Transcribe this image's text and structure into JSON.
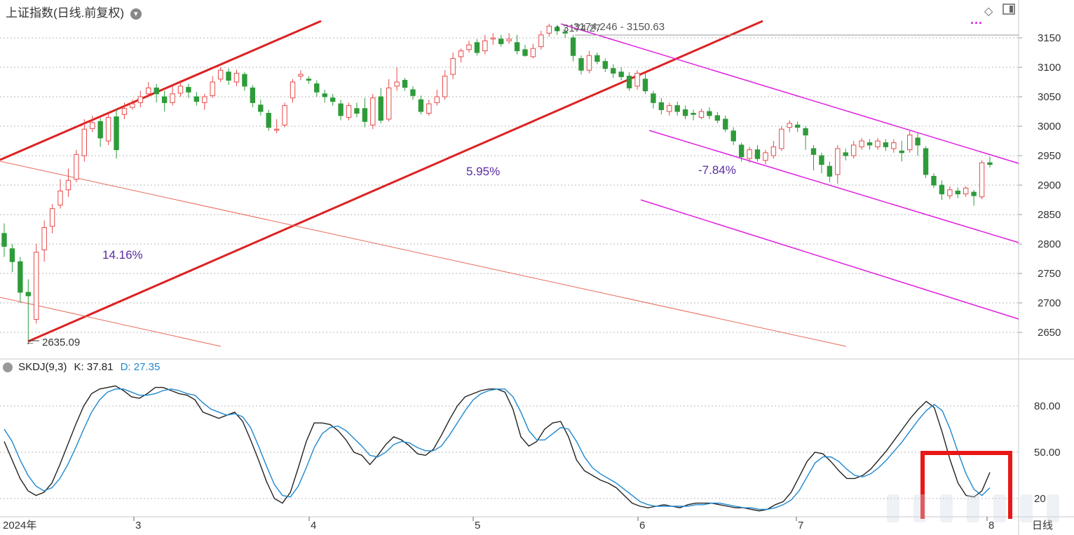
{
  "header": {
    "title": "上证指数(日线.前复权)",
    "dropdown_icon": "chevron-down-icon",
    "draw_tool_icon": "diamond-icon",
    "panel_toggle_icon": "panel-icon",
    "legend_dots": "..."
  },
  "indicator": {
    "name": "SKDJ(9,3)",
    "k_label": "K: 37.81",
    "d_label": "D: 27.35",
    "gear_icon": "gear-icon"
  },
  "colors": {
    "up": "#e84a4a",
    "down": "#2e9b3a",
    "trend_red": "#dd2222",
    "trend_thin": "#e86a5a",
    "channel_magenta": "#e020e0",
    "k_line": "#222222",
    "d_line": "#1e88d0",
    "grid": "#b8b8b8",
    "annot_purple": "#5a2aa0",
    "highlight_box": "#e81818"
  },
  "chart_data": [
    {
      "type": "candlestick",
      "title": "上证指数(日线.前复权)",
      "y_axis_labels": [
        "3150",
        "3100",
        "3050",
        "3000",
        "2950",
        "2900",
        "2850",
        "2800",
        "2750",
        "2700",
        "2650"
      ],
      "ylim": [
        2620,
        3185
      ],
      "x_axis_labels": [
        "2024年",
        "3",
        "4",
        "5",
        "6",
        "7",
        "8",
        "日线"
      ],
      "annotations": {
        "low": "2635.09",
        "high": "3174.27",
        "high_range": "3174.246 - 3150.63",
        "pct_up_1": "14.16%",
        "pct_up_2": "5.95%",
        "pct_down": "-7.84%"
      },
      "candles": [
        [
          2818,
          2796,
          2835,
          2778
        ],
        [
          2792,
          2770,
          2800,
          2752
        ],
        [
          2770,
          2718,
          2778,
          2700
        ],
        [
          2718,
          2712,
          2740,
          2635
        ],
        [
          2672,
          2786,
          2800,
          2665
        ],
        [
          2790,
          2828,
          2840,
          2770
        ],
        [
          2830,
          2860,
          2868,
          2818
        ],
        [
          2866,
          2890,
          2910,
          2860
        ],
        [
          2892,
          2908,
          2928,
          2880
        ],
        [
          2910,
          2952,
          2960,
          2905
        ],
        [
          2950,
          2995,
          3012,
          2940
        ],
        [
          2996,
          3006,
          3018,
          2990
        ],
        [
          3008,
          2980,
          3014,
          2965
        ],
        [
          2975,
          3015,
          3022,
          2968
        ],
        [
          3016,
          2960,
          3030,
          2945
        ],
        [
          3020,
          3030,
          3040,
          3012
        ],
        [
          3032,
          3038,
          3045,
          3028
        ],
        [
          3040,
          3050,
          3060,
          3032
        ],
        [
          3055,
          3065,
          3075,
          3050
        ],
        [
          3065,
          3055,
          3072,
          3040
        ],
        [
          3050,
          3040,
          3060,
          3025
        ],
        [
          3040,
          3055,
          3068,
          3035
        ],
        [
          3056,
          3068,
          3078,
          3050
        ],
        [
          3066,
          3058,
          3072,
          3048
        ],
        [
          3050,
          3042,
          3058,
          3035
        ],
        [
          3040,
          3050,
          3055,
          3028
        ],
        [
          3052,
          3075,
          3085,
          3048
        ],
        [
          3080,
          3095,
          3100,
          3075
        ],
        [
          3092,
          3078,
          3098,
          3070
        ],
        [
          3075,
          3090,
          3096,
          3068
        ],
        [
          3088,
          3068,
          3092,
          3060
        ],
        [
          3065,
          3040,
          3070,
          3032
        ],
        [
          3036,
          3025,
          3045,
          3018
        ],
        [
          3022,
          2998,
          3028,
          2992
        ],
        [
          2995,
          2995,
          3012,
          2988
        ],
        [
          3002,
          3035,
          3040,
          2998
        ],
        [
          3048,
          3075,
          3080,
          3040
        ],
        [
          3085,
          3088,
          3095,
          3078
        ],
        [
          3080,
          3078,
          3085,
          3072
        ],
        [
          3072,
          3058,
          3078,
          3050
        ],
        [
          3055,
          3050,
          3062,
          3040
        ],
        [
          3048,
          3042,
          3055,
          3035
        ],
        [
          3038,
          3018,
          3045,
          3010
        ],
        [
          3015,
          3035,
          3040,
          3010
        ],
        [
          3030,
          3022,
          3040,
          3015
        ],
        [
          3030,
          3008,
          3048,
          2998
        ],
        [
          3002,
          3048,
          3055,
          2995
        ],
        [
          3050,
          3010,
          3065,
          3005
        ],
        [
          3012,
          3065,
          3080,
          3008
        ],
        [
          3068,
          3075,
          3100,
          3060
        ],
        [
          3078,
          3066,
          3082,
          3060
        ],
        [
          3062,
          3052,
          3068,
          3045
        ],
        [
          3045,
          3025,
          3052,
          3020
        ],
        [
          3022,
          3038,
          3045,
          3018
        ],
        [
          3040,
          3050,
          3062,
          3035
        ],
        [
          3050,
          3085,
          3095,
          3045
        ],
        [
          3088,
          3115,
          3125,
          3080
        ],
        [
          3118,
          3128,
          3132,
          3108
        ],
        [
          3130,
          3138,
          3145,
          3125
        ],
        [
          3142,
          3125,
          3148,
          3120
        ],
        [
          3128,
          3145,
          3155,
          3122
        ],
        [
          3148,
          3150,
          3158,
          3138
        ],
        [
          3148,
          3140,
          3155,
          3135
        ],
        [
          3145,
          3148,
          3158,
          3140
        ],
        [
          3142,
          3128,
          3155,
          3122
        ],
        [
          3130,
          3120,
          3138,
          3118
        ],
        [
          3118,
          3132,
          3140,
          3115
        ],
        [
          3135,
          3155,
          3162,
          3130
        ],
        [
          3158,
          3170,
          3174,
          3152
        ],
        [
          3168,
          3162,
          3172,
          3155
        ],
        [
          3160,
          3158,
          3168,
          3150
        ],
        [
          3150,
          3120,
          3155,
          3110
        ],
        [
          3115,
          3095,
          3120,
          3088
        ],
        [
          3095,
          3120,
          3128,
          3090
        ],
        [
          3120,
          3110,
          3125,
          3105
        ],
        [
          3110,
          3098,
          3115,
          3092
        ],
        [
          3098,
          3090,
          3105,
          3082
        ],
        [
          3092,
          3084,
          3100,
          3078
        ],
        [
          3085,
          3065,
          3092,
          3060
        ],
        [
          3068,
          3090,
          3095,
          3062
        ],
        [
          3080,
          3060,
          3090,
          3055
        ],
        [
          3055,
          3040,
          3060,
          3030
        ],
        [
          3040,
          3028,
          3048,
          3020
        ],
        [
          3025,
          3035,
          3040,
          3018
        ],
        [
          3035,
          3025,
          3042,
          3018
        ],
        [
          3028,
          3018,
          3035,
          3012
        ],
        [
          3022,
          3020,
          3028,
          3010
        ],
        [
          3015,
          3025,
          3030,
          3012
        ],
        [
          3025,
          3018,
          3032,
          3012
        ],
        [
          3018,
          3010,
          3024,
          3005
        ],
        [
          3012,
          2995,
          3018,
          2990
        ],
        [
          2992,
          2975,
          2998,
          2968
        ],
        [
          2968,
          2948,
          2972,
          2940
        ],
        [
          2945,
          2960,
          2965,
          2938
        ],
        [
          2960,
          2945,
          2968,
          2940
        ],
        [
          2942,
          2955,
          2960,
          2935
        ],
        [
          2950,
          2965,
          2975,
          2945
        ],
        [
          2962,
          2995,
          3000,
          2958
        ],
        [
          2998,
          3005,
          3010,
          2990
        ],
        [
          3002,
          2998,
          3008,
          2990
        ],
        [
          2996,
          2985,
          3000,
          2960
        ],
        [
          2962,
          2952,
          2968,
          2925
        ],
        [
          2950,
          2935,
          2955,
          2920
        ],
        [
          2932,
          2915,
          2940,
          2905
        ],
        [
          2918,
          2962,
          2968,
          2902
        ],
        [
          2955,
          2950,
          2962,
          2942
        ],
        [
          2950,
          2968,
          2975,
          2945
        ],
        [
          2965,
          2975,
          2980,
          2960
        ],
        [
          2972,
          2968,
          2978,
          2960
        ],
        [
          2965,
          2975,
          2980,
          2960
        ],
        [
          2972,
          2965,
          2978,
          2958
        ],
        [
          2962,
          2972,
          2978,
          2955
        ],
        [
          2958,
          2955,
          2975,
          2940
        ],
        [
          2960,
          2985,
          2992,
          2955
        ],
        [
          2980,
          2968,
          2988,
          2950
        ],
        [
          2962,
          2918,
          2966,
          2912
        ],
        [
          2915,
          2900,
          2920,
          2895
        ],
        [
          2900,
          2885,
          2908,
          2875
        ],
        [
          2882,
          2892,
          2898,
          2876
        ],
        [
          2890,
          2885,
          2896,
          2878
        ],
        [
          2885,
          2895,
          2898,
          2880
        ],
        [
          2888,
          2882,
          2892,
          2865
        ],
        [
          2880,
          2938,
          2942,
          2876
        ],
        [
          2938,
          2935,
          2948,
          2930
        ]
      ]
    },
    {
      "type": "line",
      "title": "SKDJ(9,3)",
      "y_axis_labels": [
        "80.00",
        "50.00",
        "20"
      ],
      "ylim": [
        10,
        100
      ],
      "series": [
        {
          "name": "K",
          "values": [
            57,
            45,
            33,
            25,
            22,
            24,
            30,
            42,
            55,
            68,
            80,
            88,
            91,
            92,
            93,
            90,
            86,
            85,
            88,
            92,
            92,
            90,
            88,
            87,
            84,
            76,
            74,
            72,
            74,
            76,
            70,
            58,
            45,
            31,
            20,
            17,
            24,
            40,
            57,
            69,
            69,
            68,
            64,
            58,
            50,
            48,
            42,
            48,
            55,
            60,
            58,
            54,
            49,
            48,
            52,
            61,
            71,
            80,
            86,
            88,
            90,
            91,
            91,
            89,
            78,
            60,
            54,
            57,
            65,
            69,
            70,
            60,
            45,
            38,
            35,
            32,
            30,
            27,
            22,
            17,
            15,
            14,
            15,
            16,
            15,
            14,
            16,
            17,
            17,
            17,
            16,
            15,
            14,
            14,
            13,
            12,
            13,
            16,
            18,
            24,
            34,
            44,
            50,
            49,
            44,
            38,
            33,
            33,
            35,
            39,
            45,
            51,
            58,
            65,
            72,
            78,
            83,
            79,
            63,
            45,
            30,
            22,
            21,
            25,
            37
          ]
        },
        {
          "name": "D",
          "values": [
            65,
            57,
            45,
            35,
            28,
            25,
            27,
            33,
            42,
            53,
            65,
            76,
            84,
            89,
            91,
            91,
            89,
            87,
            87,
            88,
            90,
            91,
            90,
            88,
            87,
            82,
            78,
            76,
            74,
            75,
            73,
            66,
            54,
            41,
            29,
            22,
            21,
            28,
            40,
            53,
            62,
            66,
            67,
            64,
            59,
            54,
            48,
            47,
            50,
            55,
            57,
            56,
            53,
            51,
            51,
            54,
            61,
            69,
            77,
            84,
            88,
            90,
            91,
            91,
            86,
            76,
            64,
            58,
            58,
            62,
            66,
            65,
            57,
            47,
            40,
            36,
            33,
            30,
            26,
            22,
            18,
            16,
            15,
            15,
            15,
            15,
            15,
            16,
            16,
            17,
            17,
            16,
            15,
            14,
            14,
            13,
            13,
            14,
            16,
            19,
            25,
            34,
            43,
            47,
            47,
            44,
            39,
            35,
            34,
            36,
            40,
            45,
            51,
            57,
            64,
            71,
            77,
            81,
            77,
            65,
            50,
            36,
            26,
            22,
            27
          ]
        }
      ]
    }
  ]
}
